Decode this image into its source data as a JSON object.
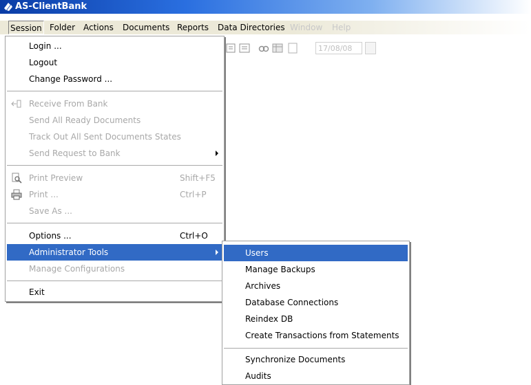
{
  "window": {
    "title": "AS-ClientBank"
  },
  "menubar": {
    "items": [
      {
        "label": "Session"
      },
      {
        "label": "Folder"
      },
      {
        "label": "Actions"
      },
      {
        "label": "Documents"
      },
      {
        "label": "Reports"
      },
      {
        "label": "Data Directories"
      },
      {
        "label": "Window"
      },
      {
        "label": "Help"
      }
    ]
  },
  "toolbar": {
    "date_value": "17/08/08"
  },
  "session_menu": {
    "login": "Login ...",
    "logout": "Logout",
    "change_password": "Change Password ...",
    "receive_from_bank": "Receive From Bank",
    "send_all_ready": "Send All Ready Documents",
    "track_out": "Track Out All Sent Documents States",
    "send_request": "Send Request to Bank",
    "print_preview": "Print Preview",
    "print_preview_shortcut": "Shift+F5",
    "print": "Print ...",
    "print_shortcut": "Ctrl+P",
    "save_as": "Save As ...",
    "options": "Options ...",
    "options_shortcut": "Ctrl+O",
    "administrator_tools": "Administrator Tools",
    "manage_configurations": "Manage Configurations",
    "exit": "Exit"
  },
  "admin_submenu": {
    "users": "Users",
    "manage_backups": "Manage Backups",
    "archives": "Archives",
    "database_connections": "Database Connections",
    "reindex_db": "Reindex DB",
    "create_transactions": "Create Transactions from Statements",
    "synchronize_documents": "Synchronize Documents",
    "audits": "Audits"
  },
  "colors": {
    "highlight": "#316ac5",
    "menu_bg": "#ffffff",
    "menubar_bg": "#ece9d8",
    "disabled_text": "#a8a8a8"
  }
}
